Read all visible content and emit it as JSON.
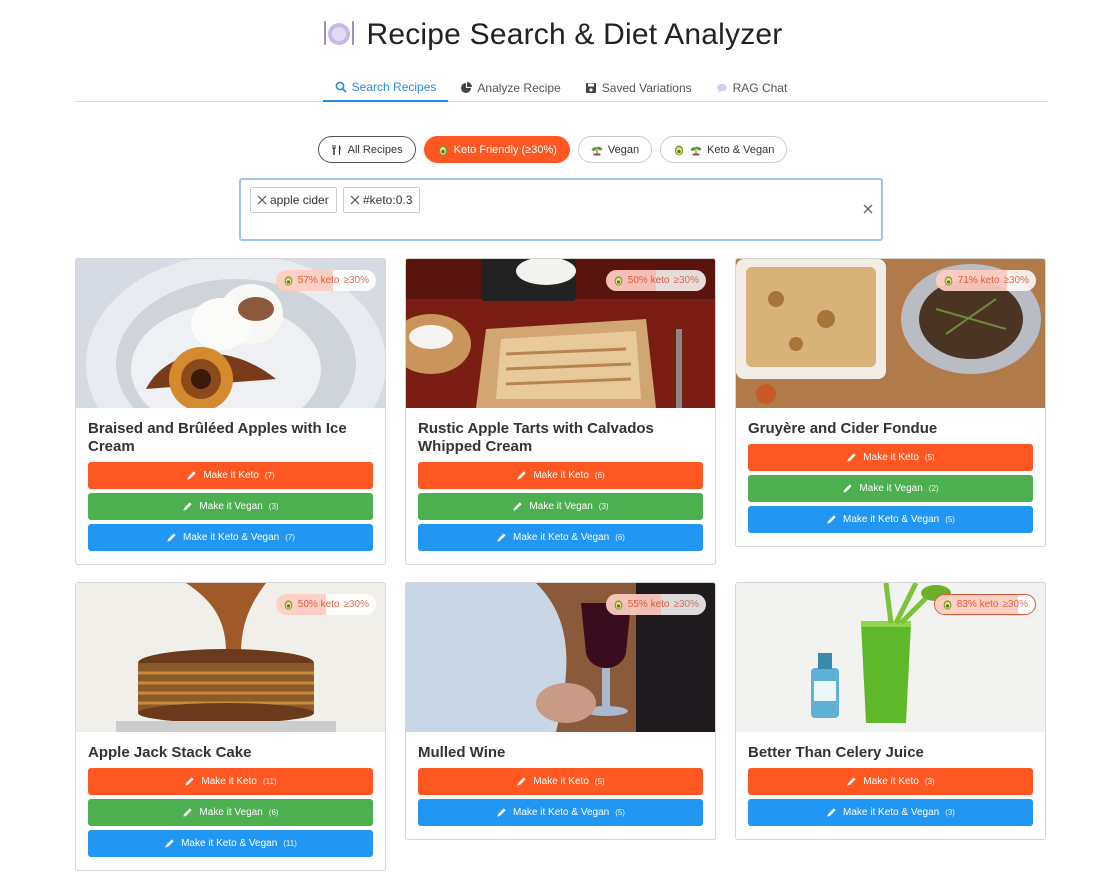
{
  "app": {
    "title": "Recipe Search & Diet Analyzer",
    "title_icon": "plate-icon"
  },
  "tabs": [
    {
      "label": "Search Recipes",
      "icon": "search-icon",
      "active": true
    },
    {
      "label": "Analyze Recipe",
      "icon": "pie-chart-icon",
      "active": false
    },
    {
      "label": "Saved Variations",
      "icon": "save-icon",
      "active": false
    },
    {
      "label": "RAG Chat",
      "icon": "chat-icon",
      "active": false
    }
  ],
  "filters": [
    {
      "label": "All Recipes",
      "icon": "utensils-icon",
      "active": false
    },
    {
      "label": "Keto Friendly (≥30%)",
      "icon": "avocado-icon",
      "active": true
    },
    {
      "label": "Vegan",
      "icon": "sprout-icon",
      "active": false
    },
    {
      "label": "Keto & Vegan",
      "icon": "avocado-sprout-icon",
      "active": false
    }
  ],
  "search": {
    "chips": [
      "apple cider",
      "#keto:0.3"
    ]
  },
  "colors": {
    "keto": "#ff5722",
    "vegan": "#4caf50",
    "keto_vegan": "#2196f3",
    "accent": "#2a8bd8"
  },
  "recipes": [
    {
      "title": "Braised and Brûléed Apples with Ice Cream",
      "keto_pct": 57,
      "keto_label": "57% keto",
      "threshold": "≥30%",
      "buttons": [
        {
          "label": "Make it Keto",
          "count": "(7)",
          "kind": "keto"
        },
        {
          "label": "Make it Vegan",
          "count": "(3)",
          "kind": "vegan"
        },
        {
          "label": "Make it Keto & Vegan",
          "count": "(7)",
          "kind": "kv"
        }
      ]
    },
    {
      "title": "Rustic Apple Tarts with Calvados Whipped Cream",
      "keto_pct": 50,
      "keto_label": "50% keto",
      "threshold": "≥30%",
      "buttons": [
        {
          "label": "Make it Keto",
          "count": "(6)",
          "kind": "keto"
        },
        {
          "label": "Make it Vegan",
          "count": "(3)",
          "kind": "vegan"
        },
        {
          "label": "Make it Keto & Vegan",
          "count": "(6)",
          "kind": "kv"
        }
      ]
    },
    {
      "title": "Gruyère and Cider Fondue",
      "keto_pct": 71,
      "keto_label": "71% keto",
      "threshold": "≥30%",
      "buttons": [
        {
          "label": "Make it Keto",
          "count": "(5)",
          "kind": "keto"
        },
        {
          "label": "Make it Vegan",
          "count": "(2)",
          "kind": "vegan"
        },
        {
          "label": "Make it Keto & Vegan",
          "count": "(5)",
          "kind": "kv"
        }
      ]
    },
    {
      "title": "Apple Jack Stack Cake",
      "keto_pct": 50,
      "keto_label": "50% keto",
      "threshold": "≥30%",
      "buttons": [
        {
          "label": "Make it Keto",
          "count": "(11)",
          "kind": "keto"
        },
        {
          "label": "Make it Vegan",
          "count": "(6)",
          "kind": "vegan"
        },
        {
          "label": "Make it Keto & Vegan",
          "count": "(11)",
          "kind": "kv"
        }
      ]
    },
    {
      "title": "Mulled Wine",
      "keto_pct": 55,
      "keto_label": "55% keto",
      "threshold": "≥30%",
      "buttons": [
        {
          "label": "Make it Keto",
          "count": "(5)",
          "kind": "keto"
        },
        {
          "label": "Make it Keto & Vegan",
          "count": "(5)",
          "kind": "kv"
        }
      ]
    },
    {
      "title": "Better Than Celery Juice",
      "keto_pct": 83,
      "keto_label": "83% keto",
      "threshold": "≥30%",
      "buttons": [
        {
          "label": "Make it Keto",
          "count": "(3)",
          "kind": "keto"
        },
        {
          "label": "Make it Keto & Vegan",
          "count": "(3)",
          "kind": "kv"
        }
      ]
    }
  ]
}
